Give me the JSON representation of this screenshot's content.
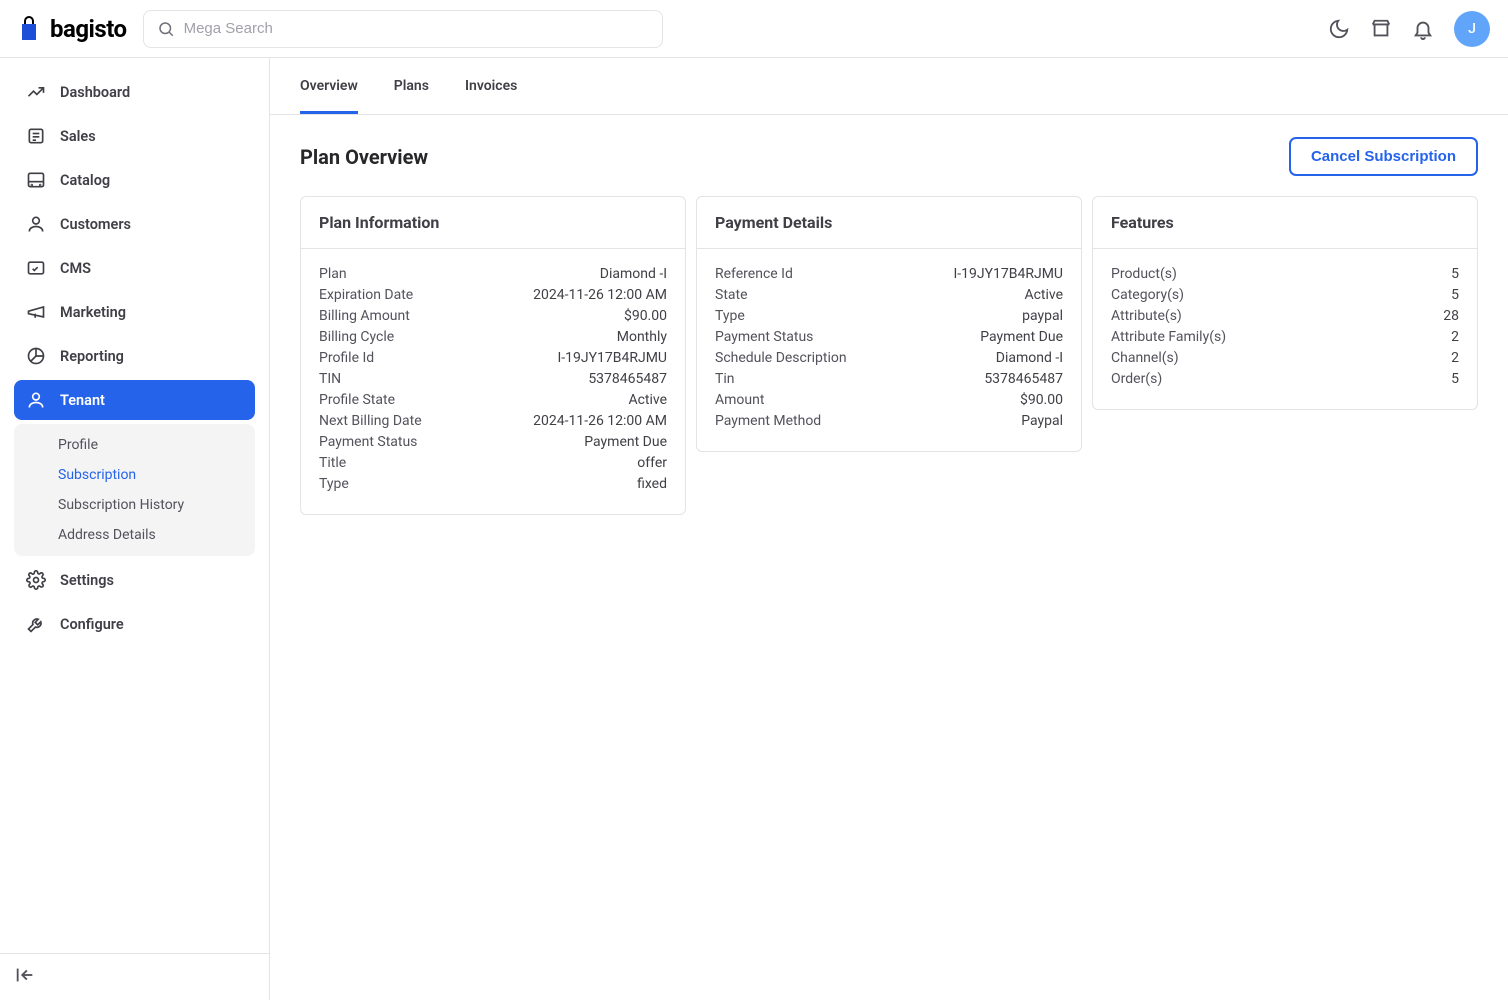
{
  "brand": "bagisto",
  "search": {
    "placeholder": "Mega Search"
  },
  "avatar_initial": "J",
  "sidebar": {
    "items": [
      {
        "label": "Dashboard"
      },
      {
        "label": "Sales"
      },
      {
        "label": "Catalog"
      },
      {
        "label": "Customers"
      },
      {
        "label": "CMS"
      },
      {
        "label": "Marketing"
      },
      {
        "label": "Reporting"
      },
      {
        "label": "Tenant"
      },
      {
        "label": "Settings"
      },
      {
        "label": "Configure"
      }
    ],
    "tenant_sub": [
      {
        "label": "Profile"
      },
      {
        "label": "Subscription"
      },
      {
        "label": "Subscription History"
      },
      {
        "label": "Address Details"
      }
    ]
  },
  "tabs": [
    {
      "label": "Overview"
    },
    {
      "label": "Plans"
    },
    {
      "label": "Invoices"
    }
  ],
  "page_title": "Plan Overview",
  "cancel_label": "Cancel Subscription",
  "cards": {
    "plan_info": {
      "title": "Plan Information",
      "rows": [
        {
          "label": "Plan",
          "value": "Diamond -I"
        },
        {
          "label": "Expiration Date",
          "value": "2024-11-26 12:00 AM"
        },
        {
          "label": "Billing Amount",
          "value": "$90.00"
        },
        {
          "label": "Billing Cycle",
          "value": "Monthly"
        },
        {
          "label": "Profile Id",
          "value": "I-19JY17B4RJMU"
        },
        {
          "label": "TIN",
          "value": "5378465487"
        },
        {
          "label": "Profile State",
          "value": "Active"
        },
        {
          "label": "Next Billing Date",
          "value": "2024-11-26 12:00 AM"
        },
        {
          "label": "Payment Status",
          "value": "Payment Due"
        },
        {
          "label": "Title",
          "value": "offer"
        },
        {
          "label": "Type",
          "value": "fixed"
        }
      ]
    },
    "payment_details": {
      "title": "Payment Details",
      "rows": [
        {
          "label": "Reference Id",
          "value": "I-19JY17B4RJMU"
        },
        {
          "label": "State",
          "value": "Active"
        },
        {
          "label": "Type",
          "value": "paypal"
        },
        {
          "label": "Payment Status",
          "value": "Payment Due"
        },
        {
          "label": "Schedule Description",
          "value": "Diamond -I"
        },
        {
          "label": "Tin",
          "value": "5378465487"
        },
        {
          "label": "Amount",
          "value": "$90.00"
        },
        {
          "label": "Payment Method",
          "value": "Paypal"
        }
      ]
    },
    "features": {
      "title": "Features",
      "rows": [
        {
          "label": "Product(s)",
          "value": "5"
        },
        {
          "label": "Category(s)",
          "value": "5"
        },
        {
          "label": "Attribute(s)",
          "value": "28"
        },
        {
          "label": "Attribute Family(s)",
          "value": "2"
        },
        {
          "label": "Channel(s)",
          "value": "2"
        },
        {
          "label": "Order(s)",
          "value": "5"
        }
      ]
    }
  }
}
